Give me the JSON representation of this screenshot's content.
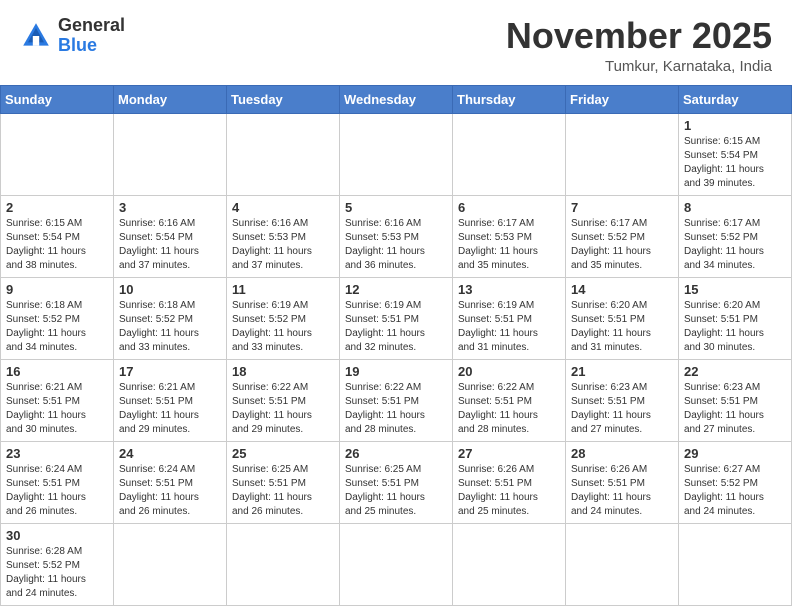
{
  "logo": {
    "general": "General",
    "blue": "Blue"
  },
  "header": {
    "month_title": "November 2025",
    "location": "Tumkur, Karnataka, India"
  },
  "weekdays": [
    "Sunday",
    "Monday",
    "Tuesday",
    "Wednesday",
    "Thursday",
    "Friday",
    "Saturday"
  ],
  "weeks": [
    [
      {
        "day": "",
        "info": ""
      },
      {
        "day": "",
        "info": ""
      },
      {
        "day": "",
        "info": ""
      },
      {
        "day": "",
        "info": ""
      },
      {
        "day": "",
        "info": ""
      },
      {
        "day": "",
        "info": ""
      },
      {
        "day": "1",
        "info": "Sunrise: 6:15 AM\nSunset: 5:54 PM\nDaylight: 11 hours\nand 39 minutes."
      }
    ],
    [
      {
        "day": "2",
        "info": "Sunrise: 6:15 AM\nSunset: 5:54 PM\nDaylight: 11 hours\nand 38 minutes."
      },
      {
        "day": "3",
        "info": "Sunrise: 6:16 AM\nSunset: 5:54 PM\nDaylight: 11 hours\nand 37 minutes."
      },
      {
        "day": "4",
        "info": "Sunrise: 6:16 AM\nSunset: 5:53 PM\nDaylight: 11 hours\nand 37 minutes."
      },
      {
        "day": "5",
        "info": "Sunrise: 6:16 AM\nSunset: 5:53 PM\nDaylight: 11 hours\nand 36 minutes."
      },
      {
        "day": "6",
        "info": "Sunrise: 6:17 AM\nSunset: 5:53 PM\nDaylight: 11 hours\nand 35 minutes."
      },
      {
        "day": "7",
        "info": "Sunrise: 6:17 AM\nSunset: 5:52 PM\nDaylight: 11 hours\nand 35 minutes."
      },
      {
        "day": "8",
        "info": "Sunrise: 6:17 AM\nSunset: 5:52 PM\nDaylight: 11 hours\nand 34 minutes."
      }
    ],
    [
      {
        "day": "9",
        "info": "Sunrise: 6:18 AM\nSunset: 5:52 PM\nDaylight: 11 hours\nand 34 minutes."
      },
      {
        "day": "10",
        "info": "Sunrise: 6:18 AM\nSunset: 5:52 PM\nDaylight: 11 hours\nand 33 minutes."
      },
      {
        "day": "11",
        "info": "Sunrise: 6:19 AM\nSunset: 5:52 PM\nDaylight: 11 hours\nand 33 minutes."
      },
      {
        "day": "12",
        "info": "Sunrise: 6:19 AM\nSunset: 5:51 PM\nDaylight: 11 hours\nand 32 minutes."
      },
      {
        "day": "13",
        "info": "Sunrise: 6:19 AM\nSunset: 5:51 PM\nDaylight: 11 hours\nand 31 minutes."
      },
      {
        "day": "14",
        "info": "Sunrise: 6:20 AM\nSunset: 5:51 PM\nDaylight: 11 hours\nand 31 minutes."
      },
      {
        "day": "15",
        "info": "Sunrise: 6:20 AM\nSunset: 5:51 PM\nDaylight: 11 hours\nand 30 minutes."
      }
    ],
    [
      {
        "day": "16",
        "info": "Sunrise: 6:21 AM\nSunset: 5:51 PM\nDaylight: 11 hours\nand 30 minutes."
      },
      {
        "day": "17",
        "info": "Sunrise: 6:21 AM\nSunset: 5:51 PM\nDaylight: 11 hours\nand 29 minutes."
      },
      {
        "day": "18",
        "info": "Sunrise: 6:22 AM\nSunset: 5:51 PM\nDaylight: 11 hours\nand 29 minutes."
      },
      {
        "day": "19",
        "info": "Sunrise: 6:22 AM\nSunset: 5:51 PM\nDaylight: 11 hours\nand 28 minutes."
      },
      {
        "day": "20",
        "info": "Sunrise: 6:22 AM\nSunset: 5:51 PM\nDaylight: 11 hours\nand 28 minutes."
      },
      {
        "day": "21",
        "info": "Sunrise: 6:23 AM\nSunset: 5:51 PM\nDaylight: 11 hours\nand 27 minutes."
      },
      {
        "day": "22",
        "info": "Sunrise: 6:23 AM\nSunset: 5:51 PM\nDaylight: 11 hours\nand 27 minutes."
      }
    ],
    [
      {
        "day": "23",
        "info": "Sunrise: 6:24 AM\nSunset: 5:51 PM\nDaylight: 11 hours\nand 26 minutes."
      },
      {
        "day": "24",
        "info": "Sunrise: 6:24 AM\nSunset: 5:51 PM\nDaylight: 11 hours\nand 26 minutes."
      },
      {
        "day": "25",
        "info": "Sunrise: 6:25 AM\nSunset: 5:51 PM\nDaylight: 11 hours\nand 26 minutes."
      },
      {
        "day": "26",
        "info": "Sunrise: 6:25 AM\nSunset: 5:51 PM\nDaylight: 11 hours\nand 25 minutes."
      },
      {
        "day": "27",
        "info": "Sunrise: 6:26 AM\nSunset: 5:51 PM\nDaylight: 11 hours\nand 25 minutes."
      },
      {
        "day": "28",
        "info": "Sunrise: 6:26 AM\nSunset: 5:51 PM\nDaylight: 11 hours\nand 24 minutes."
      },
      {
        "day": "29",
        "info": "Sunrise: 6:27 AM\nSunset: 5:52 PM\nDaylight: 11 hours\nand 24 minutes."
      }
    ],
    [
      {
        "day": "30",
        "info": "Sunrise: 6:28 AM\nSunset: 5:52 PM\nDaylight: 11 hours\nand 24 minutes."
      },
      {
        "day": "",
        "info": ""
      },
      {
        "day": "",
        "info": ""
      },
      {
        "day": "",
        "info": ""
      },
      {
        "day": "",
        "info": ""
      },
      {
        "day": "",
        "info": ""
      },
      {
        "day": "",
        "info": ""
      }
    ]
  ]
}
